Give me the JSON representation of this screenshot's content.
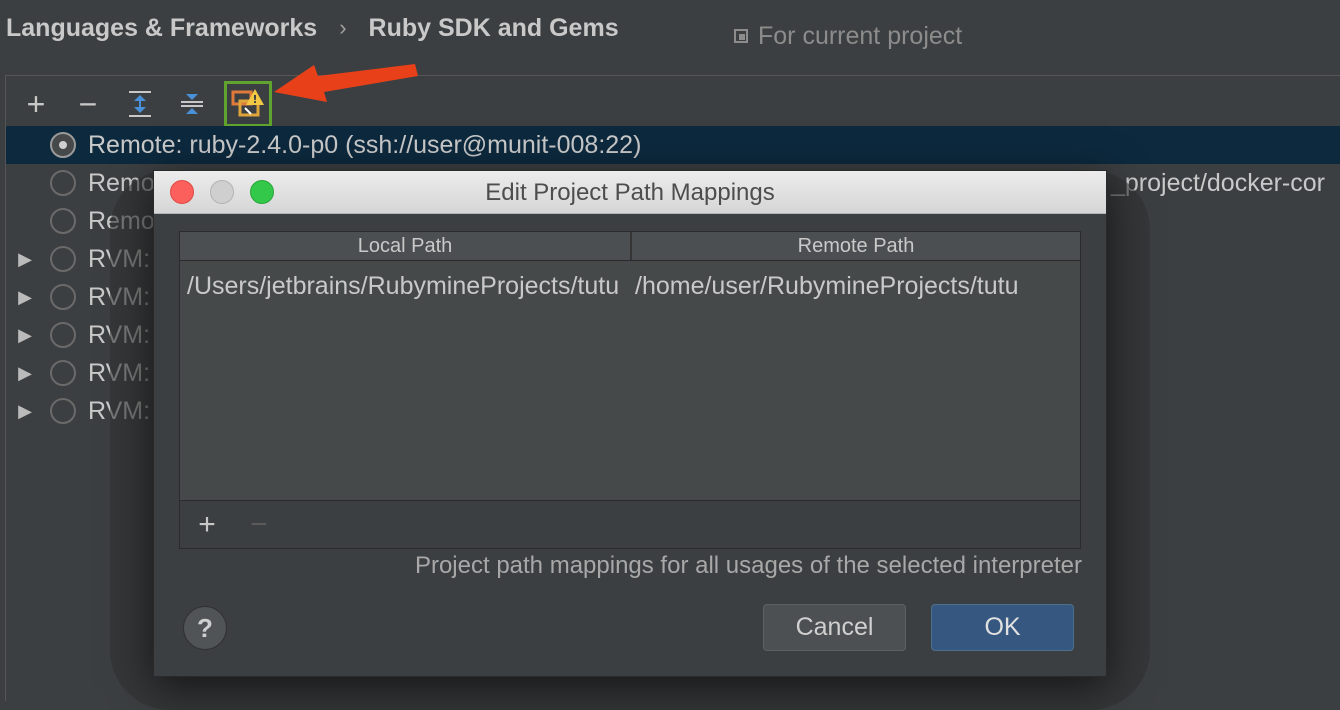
{
  "breadcrumb": {
    "parent": "Languages & Frameworks",
    "separator": "›",
    "current": "Ruby SDK and Gems"
  },
  "scope": {
    "label": "For current project"
  },
  "toolbar": {
    "add": "+",
    "remove": "−"
  },
  "sdk_list": [
    {
      "label": "Remote: ruby-2.4.0-p0 (ssh://user@munit-008:22)",
      "selected": true,
      "expandable": false,
      "tail": ""
    },
    {
      "label": "Remo",
      "selected": false,
      "expandable": false,
      "tail": "_project/docker-cor"
    },
    {
      "label": "Remo",
      "selected": false,
      "expandable": false,
      "tail": ""
    },
    {
      "label": "RVM:",
      "selected": false,
      "expandable": true,
      "tail": ""
    },
    {
      "label": "RVM:",
      "selected": false,
      "expandable": true,
      "tail": ""
    },
    {
      "label": "RVM:",
      "selected": false,
      "expandable": true,
      "tail": ""
    },
    {
      "label": "RVM:",
      "selected": false,
      "expandable": true,
      "tail": ""
    },
    {
      "label": "RVM:",
      "selected": false,
      "expandable": true,
      "tail": ""
    }
  ],
  "dialog": {
    "title": "Edit Project Path Mappings",
    "columns": [
      "Local Path",
      "Remote Path"
    ],
    "rows": [
      {
        "local": "/Users/jetbrains/RubymineProjects/tutu",
        "remote": "/home/user/RubymineProjects/tutu"
      }
    ],
    "add": "+",
    "remove": "−",
    "hint": "Project path mappings for all usages of the selected interpreter",
    "help": "?",
    "cancel": "Cancel",
    "ok": "OK"
  },
  "colors": {
    "background": "#3c3f41",
    "selection": "#0d293e",
    "ok_button": "#365880",
    "highlight_border": "#61a32f",
    "arrow": "#e8411a"
  }
}
